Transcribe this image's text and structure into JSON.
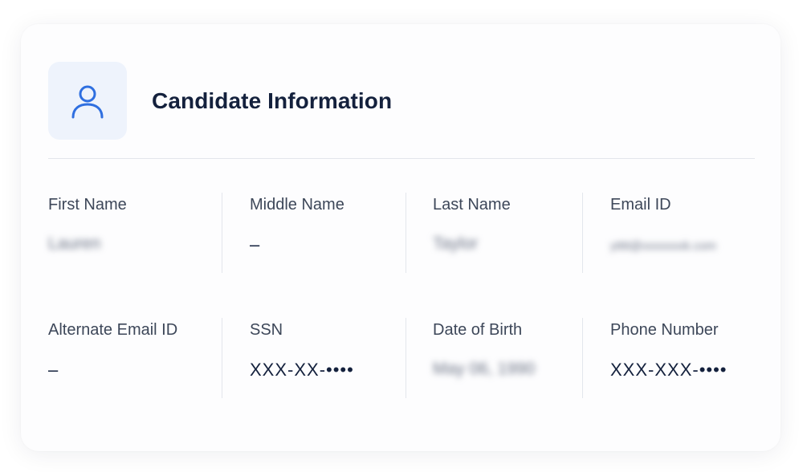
{
  "card": {
    "title": "Candidate Information",
    "avatar_icon": "user-icon",
    "accent_color": "#2f6fe0"
  },
  "fields_row1": [
    {
      "label": "First Name",
      "value": "Lauren"
    },
    {
      "label": "Middle Name",
      "value": "–"
    },
    {
      "label": "Last Name",
      "value": "Taylor"
    },
    {
      "label": "Email ID",
      "value": "ytttt@xxxxxxxk.com"
    }
  ],
  "fields_row2": [
    {
      "label": "Alternate Email ID",
      "value": "–"
    },
    {
      "label": "SSN",
      "value": "XXX-XX-••••"
    },
    {
      "label": "Date of Birth",
      "value": "May 06, 1990"
    },
    {
      "label": "Phone Number",
      "value": "XXX-XXX-••••"
    }
  ]
}
